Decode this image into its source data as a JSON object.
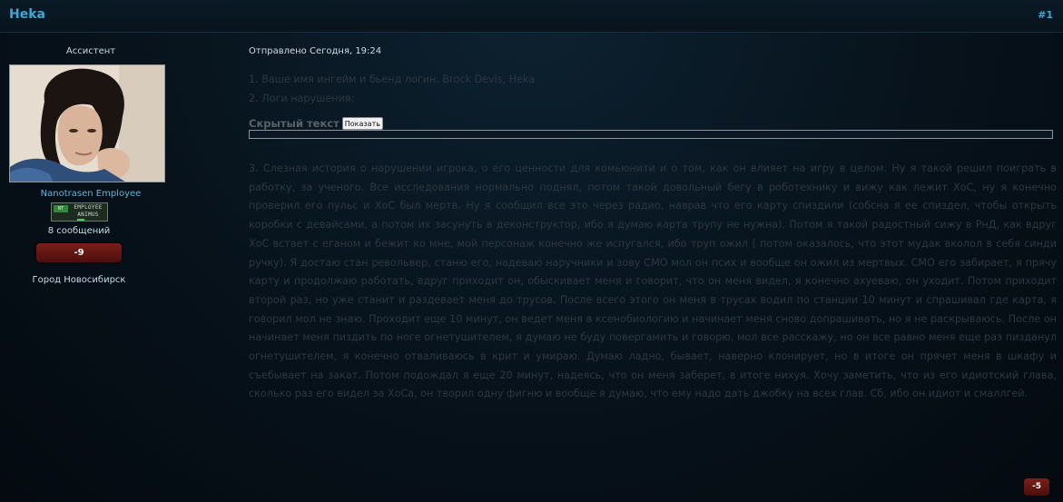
{
  "header": {
    "title": "Heka",
    "post_number": "#1"
  },
  "user": {
    "group": "Ассистент",
    "rank": "Nanotrasen Employee",
    "badge": {
      "logo": "NT",
      "text": "EMPLOYEE ANIMUS"
    },
    "post_count": "8 сообщений",
    "reputation": "-9",
    "location": "Город Новосибирск"
  },
  "post": {
    "meta": "Отправлено Сегодня, 19:24",
    "line1": "1. Ваше имя ингейм и бьенд логин. Brock Devis, Heka",
    "line2": "2. Логи нарушения:",
    "spoiler_label": "Скрытый текст",
    "spoiler_button": "Показать",
    "story": "3. Слезная история о нарушении игрока, о его ценности для комьюнити и о том, как он влияет на игру в целом. Ну я такой решил поиграть в работку, за ученого. Все исследования нормально поднял, потом такой довольный бегу в роботехнику и вижу как лежит ХоС, ну я конечно проверил его пульс и ХоС был мертв. Ну я сообщил все это через радио, наврав что его карту спиздили (собсна я ее спиздел, чтобы открыть коробки с девайсами, а потом их засунуть в деконструктор, ибо я думаю карта трупу не нужна). Потом я такой радостный сижу в РнД, как вдруг ХоС встает с еганом и бежит ко мне, мой персонаж конечно же испугался, ибо труп ожил ( потом оказалось, что этот мудак вколол в себя синди ручку). Я достаю стан револьвер, станю его, надеваю наручники и зову СМО мол он псих и вообще он ожил из мертвых. СМО его забирает, я прячу карту и продолжаю работать, вдруг приходит он, обыскивает меня и говорит, что он меня видел, я конечно ахуеваю, он уходит. Потом приходит второй раз, но уже станит и раздевает меня до трусов. После всего этого он меня в трусах водил по станции 10 минут и спрашивал где карта, я говорил мол не знаю. Проходит еще 10 минут, он ведет меня в ксенобиологию и начинает меня сново допрашивать, но я не раскрываюсь. После он начинает меня пиздить по ноге огнетушителем, я думаю не буду повергамить и говорю, мол все расскажу, но он все равно меня еще раз пизданул огнетушителем, я конечно отваливаюсь в крит и умираю. Думаю ладно, бывает, наверно клонирует, но в итоге он прячет меня в шкафу и съебывает на закат. Потом подождал я еще 20 минут, надеясь, что он меня заберет, в итоге нихуя. Хочу заметить, что из его идиотский глава, сколько раз его видел за ХоСа, он творил одну фигню и вообще я думаю, что ему надо дать джобку на всех глав. Сб, ибо он идиот и смаллгей.",
    "reputation": "-5"
  },
  "colors": {
    "accent": "#3aa9d8",
    "background": "#07121b",
    "reputation_negative": "#6a1713"
  }
}
